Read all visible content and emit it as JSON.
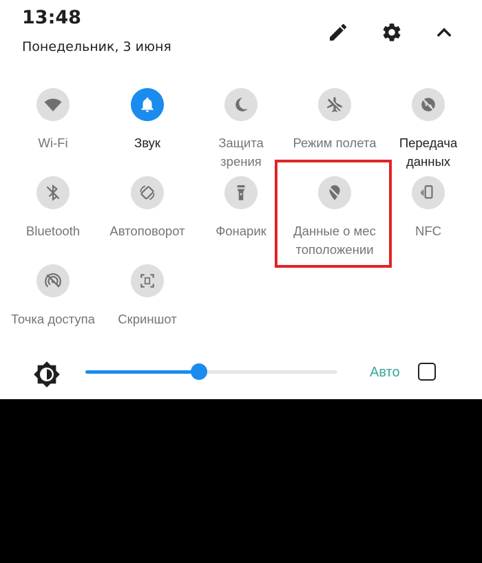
{
  "header": {
    "time": "13:48",
    "date": "Понедельник, 3 июня"
  },
  "icons": {
    "edit": "pencil-icon",
    "settings": "gear-icon",
    "collapse": "chevron-up-icon"
  },
  "tiles": [
    {
      "id": "wifi",
      "label1": "Wi-Fi",
      "label2": "",
      "active": false
    },
    {
      "id": "sound",
      "label1": "Звук",
      "label2": "",
      "active": true
    },
    {
      "id": "eye-protection",
      "label1": "Защита",
      "label2": "зрения",
      "active": false
    },
    {
      "id": "airplane",
      "label1": "Режим полета",
      "label2": "",
      "active": false
    },
    {
      "id": "mobile-data",
      "label1": "Передача",
      "label2": "данных",
      "active": false
    },
    {
      "id": "bluetooth",
      "label1": "Bluetooth",
      "label2": "",
      "active": false
    },
    {
      "id": "autorotate",
      "label1": "Автоповорот",
      "label2": "",
      "active": false
    },
    {
      "id": "flashlight",
      "label1": "Фонарик",
      "label2": "",
      "active": false
    },
    {
      "id": "location",
      "label1": "Данные о мес",
      "label2": "тоположении",
      "active": false
    },
    {
      "id": "nfc",
      "label1": "NFC",
      "label2": "",
      "active": false
    },
    {
      "id": "hotspot",
      "label1": "Точка доступа",
      "label2": "",
      "active": false
    },
    {
      "id": "screenshot",
      "label1": "Скриншот",
      "label2": "",
      "active": false
    }
  ],
  "brightness": {
    "level_percent": 45,
    "auto_label": "Авто",
    "auto_checked": false
  },
  "colors": {
    "accent": "#1a8cf0",
    "tile_inactive": "#dedede",
    "highlight": "#e02424",
    "auto_text": "#3aa39a"
  }
}
